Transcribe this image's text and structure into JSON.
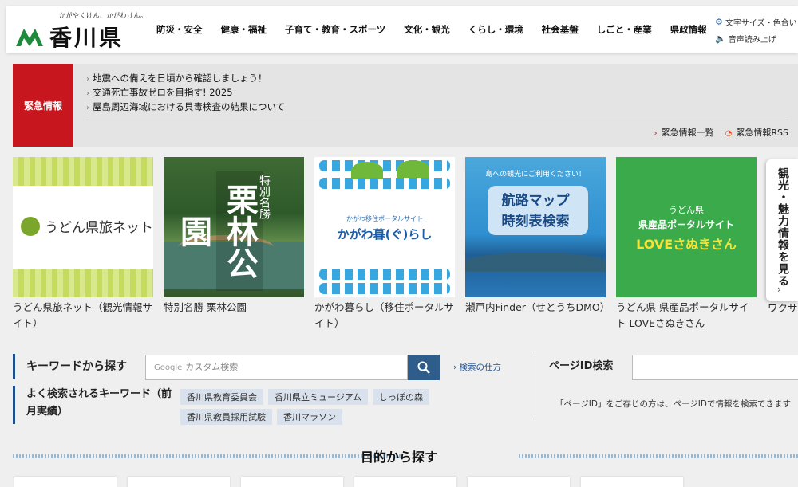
{
  "header": {
    "tagline": "かがやくけん、かがわけん。",
    "site_name": "香川県",
    "nav": [
      "防災・安全",
      "健康・福祉",
      "子育て・教育・スポーツ",
      "文化・観光",
      "くらし・環境",
      "社会基盤",
      "しごと・産業",
      "県政情報"
    ],
    "util_text_size": "文字サイズ・色合い",
    "util_read_aloud": "音声読み上げ"
  },
  "emergency": {
    "label": "緊急情報",
    "items": [
      "地震への備えを日頃から確認しましょう！",
      "交通死亡事故ゼロを目指す! 2025",
      "屋島周辺海域における貝毒検査の結果について"
    ],
    "list_link": "緊急情報一覧",
    "rss_link": "緊急情報RSS"
  },
  "banners": [
    {
      "caption": "うどん県旅ネット（観光情報サイト）",
      "logo_text": "うどん県旅ネット"
    },
    {
      "caption": "特別名勝 栗林公園",
      "title": "栗林公園",
      "sub": "特別名勝"
    },
    {
      "caption": "かがわ暮らし（移住ポータルサイト）",
      "sub": "かがわ移住ポータルサイト",
      "title": "かがわ暮(ぐ)らし"
    },
    {
      "caption": "瀬戸内Finder（せとうちDMO）",
      "top": "島への観光にご利用ください！",
      "title_line1": "航路マップ",
      "title_line2": "時刻表検索"
    },
    {
      "caption": "うどん県 県産品ポータルサイト LOVEさぬきさん",
      "sub": "うどん県",
      "title": "県産品ポータルサイト",
      "love": "LOVEさぬきさん"
    }
  ],
  "partial_caption": "ワクサ",
  "side_tab": {
    "label": "観光・魅力情報を見る",
    "arrow": "›"
  },
  "search": {
    "heading": "キーワードから探す",
    "placeholder_brand": "Google",
    "placeholder": "カスタム検索",
    "how_link": "› 検索の仕方",
    "freq_heading": "よく検索されるキーワード（前月実績）",
    "tags": [
      "香川県教育委員会",
      "香川県立ミュージアム",
      "しっぽの森",
      "香川県教員採用試験",
      "香川マラソン"
    ]
  },
  "page_id": {
    "heading": "ページID検索",
    "note": "「ページID」をご存じの方は、ページIDで情報を検索できます"
  },
  "purpose": {
    "title": "目的から探す"
  },
  "colors": {
    "emergency_red": "#c8161e",
    "navy": "#1c4f8a",
    "search_button": "#2e5d8c",
    "udon_green": "#7aa62b"
  },
  "icons": {
    "gear": "gear-icon",
    "speaker": "speaker-icon",
    "search": "search-icon",
    "rss": "rss-icon",
    "chevron": "chevron-right-icon"
  }
}
